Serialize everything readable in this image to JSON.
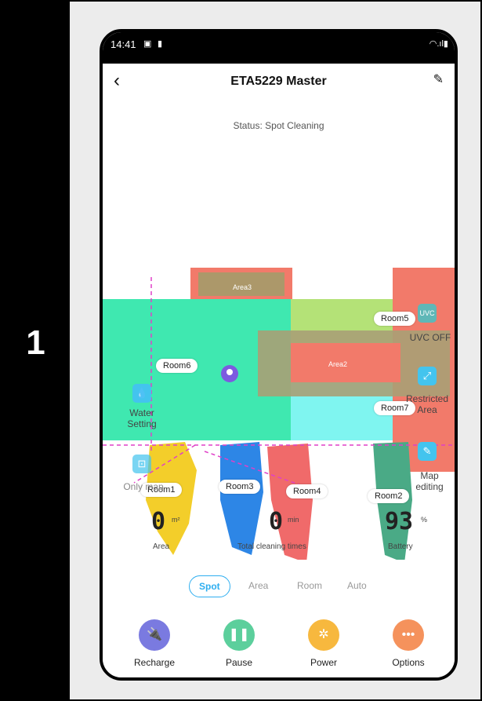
{
  "step": {
    "number": "1"
  },
  "statusbar": {
    "time": "14:41"
  },
  "header": {
    "title": "ETA5229 Master"
  },
  "status_text": "Status: Spot Cleaning",
  "map": {
    "areas": [
      "Area3",
      "Area2"
    ],
    "rooms": [
      "Room6",
      "Room5",
      "Room7",
      "Room1",
      "Room3",
      "Room4",
      "Room2"
    ]
  },
  "side_controls": {
    "uvc": {
      "icon_text": "UVC",
      "label": "UVC OFF"
    },
    "restricted": {
      "label_line1": "Restricted",
      "label_line2": "Area"
    },
    "map_edit": {
      "label_line1": "Map",
      "label_line2": "editing"
    },
    "water": {
      "label_line1": "Water",
      "label_line2": "Setting"
    },
    "only_map": {
      "label": "Only map"
    }
  },
  "stats": {
    "area": {
      "value": "0",
      "unit": "m²",
      "label": "Area"
    },
    "time": {
      "value": "0",
      "unit": "min",
      "label": "Total cleaning times"
    },
    "battery": {
      "value": "93",
      "unit": "%",
      "label": "Battery"
    }
  },
  "modes": [
    "Spot",
    "Area",
    "Room",
    "Auto"
  ],
  "actions": {
    "recharge": {
      "label": "Recharge",
      "color": "#7a7ae0"
    },
    "pause": {
      "label": "Pause",
      "color": "#5ccf9c"
    },
    "power": {
      "label": "Power",
      "color": "#f7b83e"
    },
    "options": {
      "label": "Options",
      "color": "#f5925c"
    }
  }
}
